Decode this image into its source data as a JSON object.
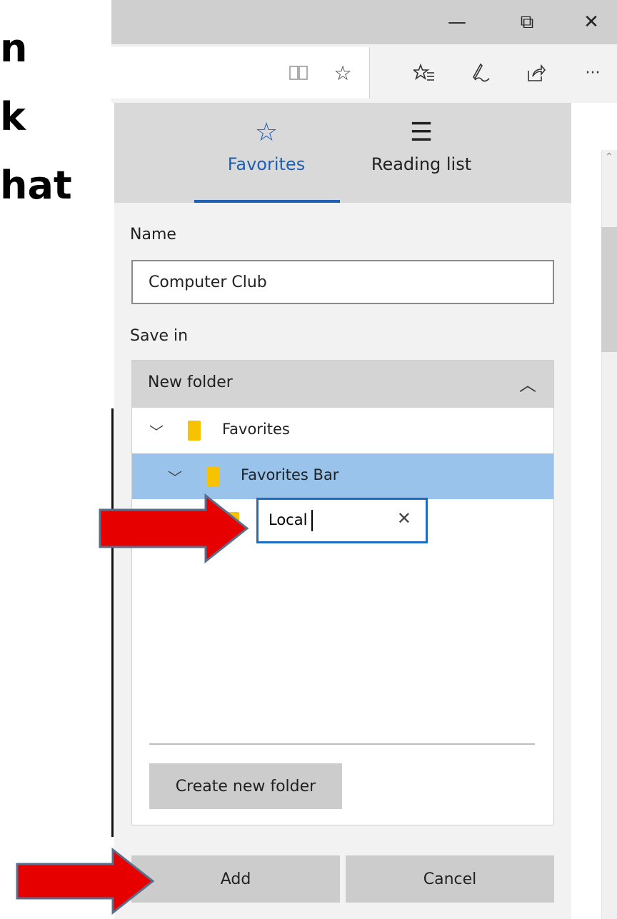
{
  "slide": {
    "lines": [
      "n",
      "k",
      "hat"
    ]
  },
  "window": {
    "minimize_glyph": "—",
    "restore_glyph": "⧉",
    "close_glyph": "✕"
  },
  "toolbar": {
    "reading_view_icon": "book-icon",
    "favorite_icon": "star-icon",
    "favorites_hub_icon": "star-list-icon",
    "web_note_icon": "pen-icon",
    "share_icon": "share-icon",
    "more_label": "···"
  },
  "panel": {
    "tabs": [
      {
        "label": "Favorites",
        "icon": "☆"
      },
      {
        "label": "Reading list",
        "icon": "☰"
      }
    ],
    "name_label": "Name",
    "name_value": "Computer Club",
    "save_in_label": "Save in",
    "folder_header": "New folder",
    "tree": [
      {
        "label": "Favorites",
        "expanded": true
      },
      {
        "label": "Favorites Bar",
        "expanded": true,
        "selected": true
      }
    ],
    "new_folder_value": "Local",
    "create_folder_label": "Create new folder",
    "add_label": "Add",
    "cancel_label": "Cancel"
  },
  "colors": {
    "accent": "#1f5fb4",
    "selected_row": "#99c3ea",
    "arrow": "#e60000"
  }
}
